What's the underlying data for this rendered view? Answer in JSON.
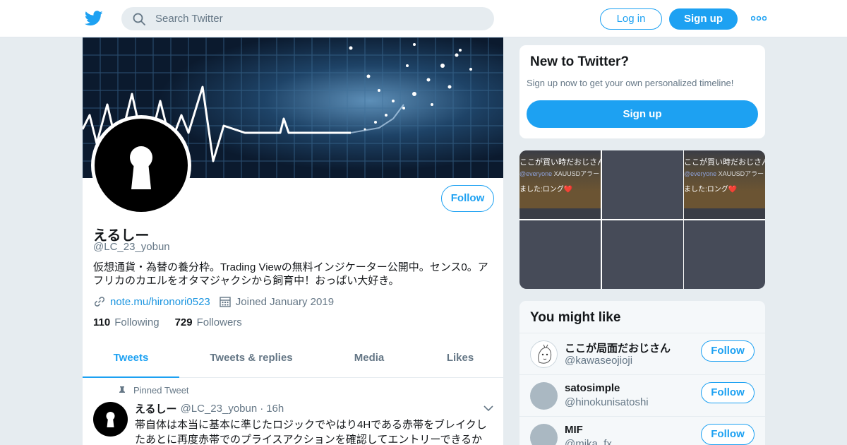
{
  "nav": {
    "search_placeholder": "Search Twitter",
    "login_label": "Log in",
    "signup_label": "Sign up",
    "more_icon": "more-dots-icon",
    "brand_color": "#1da1f2"
  },
  "profile": {
    "display_name": "えるしー",
    "handle": "@LC_23_yobun",
    "follow_label": "Follow",
    "bio": "仮想通貨・為替の養分枠。Trading Viewの無料インジケーター公開中。センス0。アフリカのカエルをオタマジャクシから飼育中！おっぱい大好き。",
    "website": "note.mu/hironori0523",
    "joined": "Joined January 2019",
    "following_count": "110",
    "following_label": "Following",
    "followers_count": "729",
    "followers_label": "Followers"
  },
  "tabs": [
    {
      "label": "Tweets",
      "active": true
    },
    {
      "label": "Tweets & replies",
      "active": false
    },
    {
      "label": "Media",
      "active": false
    },
    {
      "label": "Likes",
      "active": false
    }
  ],
  "pinned_tweet": {
    "pinned_label": "Pinned Tweet",
    "author": "えるしー",
    "handle": "@LC_23_yobun",
    "separator": "·",
    "time": "16h",
    "text": "帯自体は本当に基本に準じたロジックでやはり4Hである赤帯をブレイクしたあとに再度赤帯でのプライスアクションを確認してエントリーできるか"
  },
  "signup_card": {
    "title": "New to Twitter?",
    "subtitle": "Sign up now to get your own personalized timeline!",
    "button_label": "Sign up"
  },
  "media_tiles": [
    {
      "kind": "screenshot",
      "line1": "ここが買い時だおじさん",
      "mention": "@everyone",
      "line2_rest": " XAUUSDアラー",
      "line3": "ました:ロング❤️"
    },
    {
      "kind": "blank"
    },
    {
      "kind": "screenshot",
      "line1": "ここが買い時だおじさん",
      "mention": "@everyone",
      "line2_rest": " XAUUSDアラー",
      "line3": "ました:ロング❤️"
    },
    {
      "kind": "blank"
    },
    {
      "kind": "blank"
    },
    {
      "kind": "blank"
    }
  ],
  "you_might_like": {
    "title": "You might like",
    "accounts": [
      {
        "name": "ここが局面だおじさん",
        "handle": "@kawaseojioji",
        "follow_label": "Follow"
      },
      {
        "name": "satosimple",
        "handle": "@hinokunisatoshi",
        "follow_label": "Follow"
      },
      {
        "name": "MIF",
        "handle": "@mika_fx",
        "follow_label": "Follow"
      }
    ]
  }
}
